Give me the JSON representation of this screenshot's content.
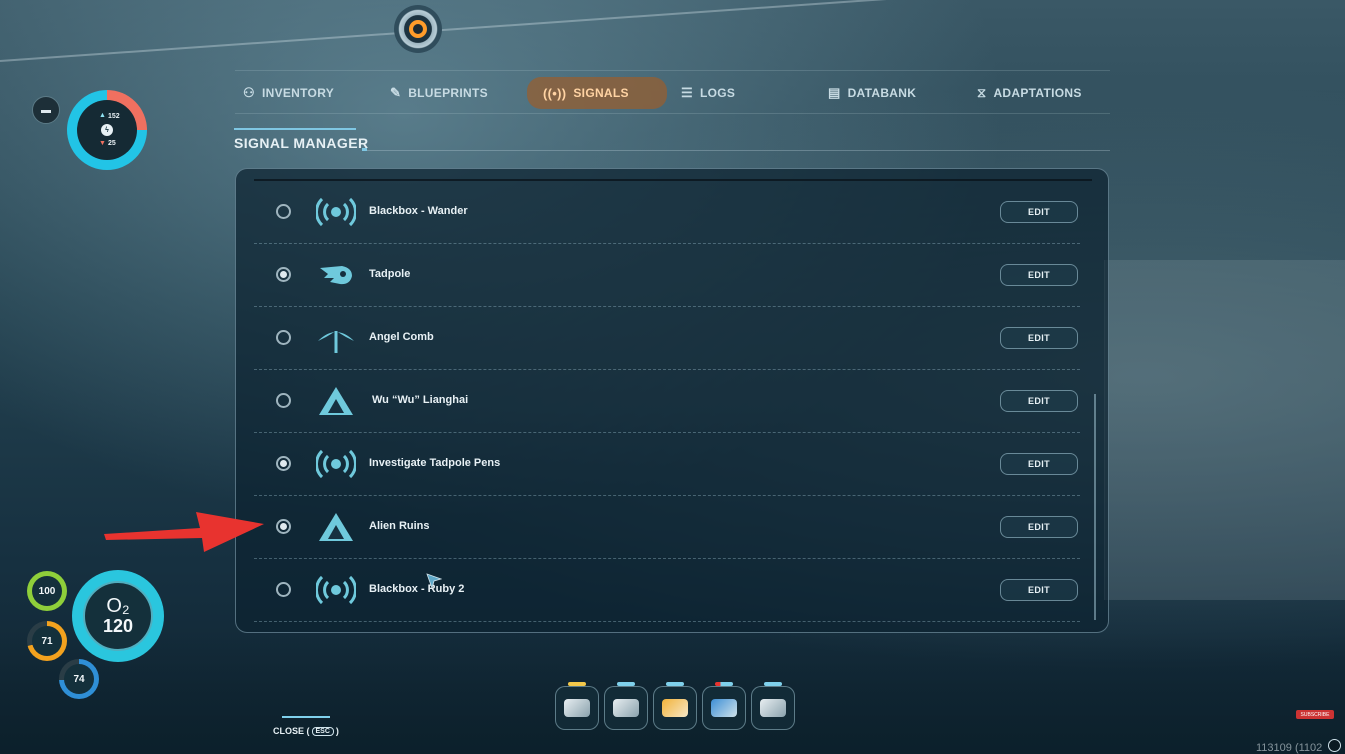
{
  "hud": {
    "energy_up": "152",
    "energy_down": "25",
    "oxygen_label": "O₂",
    "oxygen_value": "120",
    "health": "100",
    "food": "71",
    "water": "74"
  },
  "tabs": [
    {
      "label": "INVENTORY",
      "icon": "person-icon"
    },
    {
      "label": "BLUEPRINTS",
      "icon": "blueprint-icon"
    },
    {
      "label": "SIGNALS",
      "icon": "signal-icon",
      "active": true
    },
    {
      "label": "LOGS",
      "icon": "logs-icon"
    },
    {
      "label": "DATABANK",
      "icon": "databank-icon"
    },
    {
      "label": "ADAPTATIONS",
      "icon": "dna-icon"
    }
  ],
  "section_title": "SIGNAL MANAGER",
  "signals": [
    {
      "name": "Blackbox - Wander",
      "icon": "broadcast-icon",
      "selected": false
    },
    {
      "name": "Tadpole",
      "icon": "tadpole-icon",
      "selected": true
    },
    {
      "name": "Angel Comb",
      "icon": "angel-comb-icon",
      "selected": false
    },
    {
      "name": "Wu “Wu” Lianghai",
      "icon": "triangle-beacon-icon",
      "selected": false
    },
    {
      "name": "Investigate Tadpole Pens",
      "icon": "broadcast-icon",
      "selected": true
    },
    {
      "name": "Alien Ruins",
      "icon": "triangle-beacon-icon",
      "selected": true
    },
    {
      "name": "Blackbox - Ruby 2",
      "icon": "broadcast-icon",
      "selected": false
    }
  ],
  "edit_label": "EDIT",
  "close_label": "CLOSE (",
  "close_suffix": ")",
  "esc_key": "ESC",
  "youtube_label": "SUBSCRIBE",
  "coords": "113109 (1102"
}
